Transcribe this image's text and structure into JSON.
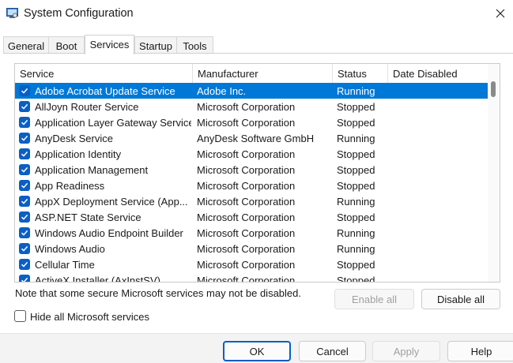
{
  "window": {
    "title": "System Configuration",
    "icon": "msconfig-icon"
  },
  "tabs": [
    {
      "label": "General",
      "active": false
    },
    {
      "label": "Boot",
      "active": false
    },
    {
      "label": "Services",
      "active": true
    },
    {
      "label": "Startup",
      "active": false
    },
    {
      "label": "Tools",
      "active": false
    }
  ],
  "list": {
    "columns": [
      "Service",
      "Manufacturer",
      "Status",
      "Date Disabled"
    ],
    "rows": [
      {
        "name": "Adobe Acrobat Update Service",
        "manufacturer": "Adobe Inc.",
        "status": "Running",
        "date": "",
        "checked": true,
        "selected": true
      },
      {
        "name": "AllJoyn Router Service",
        "manufacturer": "Microsoft Corporation",
        "status": "Stopped",
        "date": "",
        "checked": true
      },
      {
        "name": "Application Layer Gateway Service",
        "manufacturer": "Microsoft Corporation",
        "status": "Stopped",
        "date": "",
        "checked": true
      },
      {
        "name": "AnyDesk Service",
        "manufacturer": "AnyDesk Software GmbH",
        "status": "Running",
        "date": "",
        "checked": true
      },
      {
        "name": "Application Identity",
        "manufacturer": "Microsoft Corporation",
        "status": "Stopped",
        "date": "",
        "checked": true
      },
      {
        "name": "Application Management",
        "manufacturer": "Microsoft Corporation",
        "status": "Stopped",
        "date": "",
        "checked": true
      },
      {
        "name": "App Readiness",
        "manufacturer": "Microsoft Corporation",
        "status": "Stopped",
        "date": "",
        "checked": true
      },
      {
        "name": "AppX Deployment Service (App...",
        "manufacturer": "Microsoft Corporation",
        "status": "Running",
        "date": "",
        "checked": true
      },
      {
        "name": "ASP.NET State Service",
        "manufacturer": "Microsoft Corporation",
        "status": "Stopped",
        "date": "",
        "checked": true
      },
      {
        "name": "Windows Audio Endpoint Builder",
        "manufacturer": "Microsoft Corporation",
        "status": "Running",
        "date": "",
        "checked": true
      },
      {
        "name": "Windows Audio",
        "manufacturer": "Microsoft Corporation",
        "status": "Running",
        "date": "",
        "checked": true
      },
      {
        "name": "Cellular Time",
        "manufacturer": "Microsoft Corporation",
        "status": "Stopped",
        "date": "",
        "checked": true
      },
      {
        "name": "ActiveX Installer (AxInstSV)",
        "manufacturer": "Microsoft Corporation",
        "status": "Stopped",
        "date": "",
        "checked": true
      }
    ]
  },
  "note": "Note that some secure Microsoft services may not be disabled.",
  "buttons": {
    "enable_all": "Enable all",
    "disable_all": "Disable all",
    "ok": "OK",
    "cancel": "Cancel",
    "apply": "Apply",
    "help": "Help"
  },
  "hide_ms": {
    "label": "Hide all Microsoft services",
    "checked": false
  },
  "colors": {
    "selection": "#0078d7",
    "checkbox": "#0a5fc4"
  }
}
